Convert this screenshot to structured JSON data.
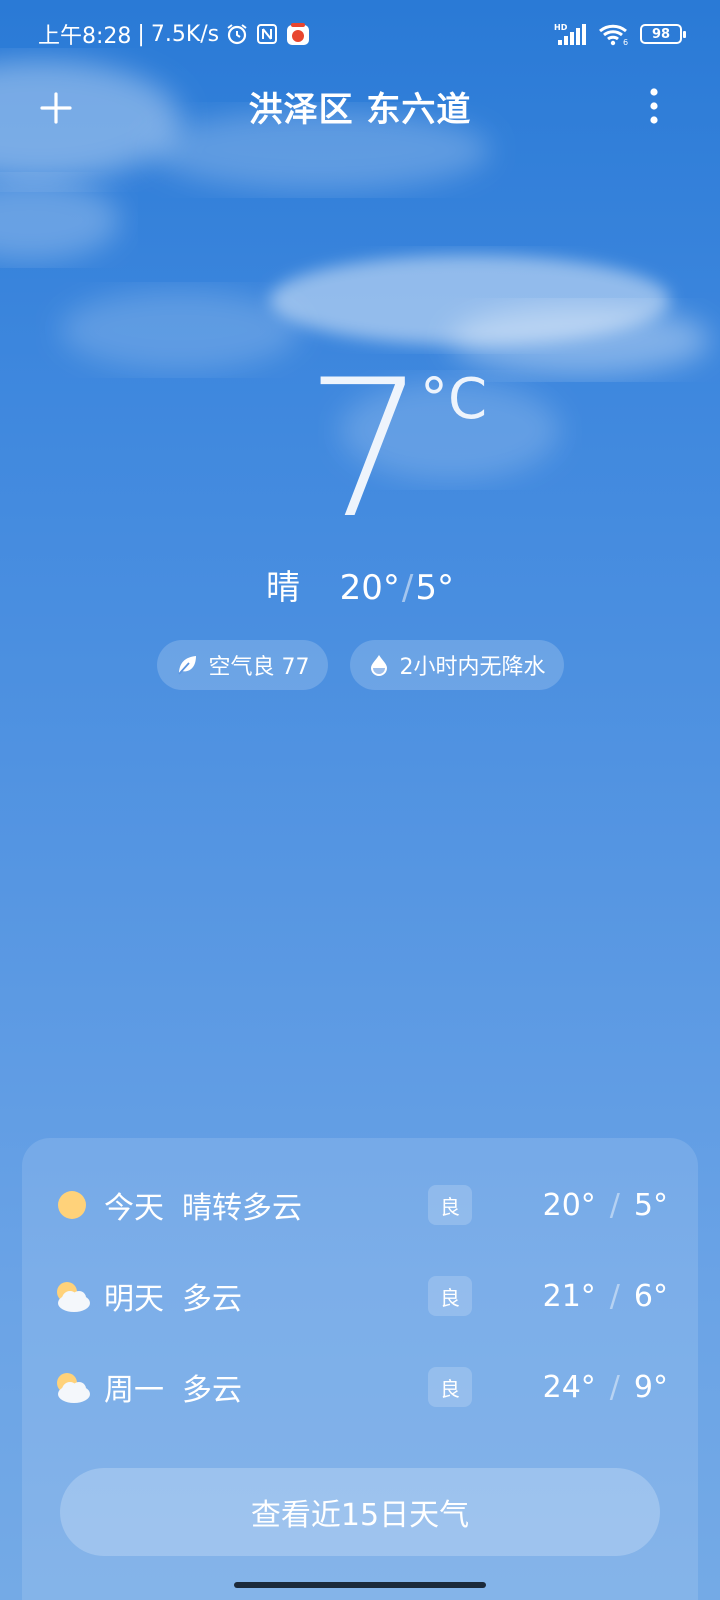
{
  "status_bar": {
    "time": "上午8:28",
    "separator": "|",
    "net_speed": "7.5K/s",
    "battery": "98",
    "icons": [
      "alarm-icon",
      "nfc-icon",
      "app-notification-icon",
      "hd-signal-icon",
      "wifi-icon",
      "battery-icon"
    ]
  },
  "header": {
    "location": "洪泽区 东六道"
  },
  "current": {
    "temperature": "7",
    "unit": "°C",
    "condition": "晴",
    "high": "20°",
    "slash": "/",
    "low": "5°"
  },
  "chips": [
    {
      "icon": "leaf-icon",
      "label": "空气良 77"
    },
    {
      "icon": "water-drop-icon",
      "label": "2小时内无降水"
    }
  ],
  "forecast": {
    "days": [
      {
        "icon": "sun-icon",
        "day": "今天",
        "condition": "晴转多云",
        "aqi": "良",
        "high": "20°",
        "low": "5°"
      },
      {
        "icon": "partly-cloudy-icon",
        "day": "明天",
        "condition": "多云",
        "aqi": "良",
        "high": "21°",
        "low": "6°"
      },
      {
        "icon": "partly-cloudy-icon",
        "day": "周一",
        "condition": "多云",
        "aqi": "良",
        "high": "24°",
        "low": "9°"
      }
    ],
    "separator": "/",
    "button_label": "查看近15日天气"
  },
  "colors": {
    "sky_top": "#2a7ad6",
    "sky_bottom": "#74aae6",
    "sun": "#ffd27a"
  }
}
